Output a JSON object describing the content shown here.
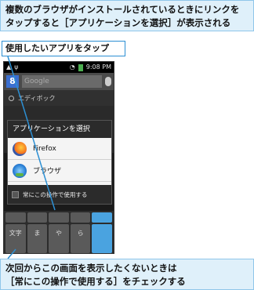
{
  "captions": {
    "top_line1": "複数のブラウザがインストールされているときにリンクを",
    "top_line2": "タップすると［アプリケーションを選択］が表示される",
    "callout": "使用したいアプリをタップ",
    "bottom_line1": "次回からこの画面を表示したくないときは",
    "bottom_line2": "［常にこの操作で使用する］をチェックする"
  },
  "statusbar": {
    "time": "9:08 PM"
  },
  "search": {
    "placeholder": "Google",
    "suggestion": "エディボック"
  },
  "dialog": {
    "title": "アプリケーションを選択",
    "apps": [
      {
        "label": "Firefox",
        "icon": "firefox-icon"
      },
      {
        "label": "ブラウザ",
        "icon": "browser-icon"
      }
    ],
    "always_use": "常にこの操作で使用する"
  },
  "keyboard": {
    "keys": [
      "",
      "",
      "",
      "",
      "",
      "文字",
      "",
      "",
      "",
      "",
      "",
      "ま",
      "や",
      "ら",
      "",
      "",
      "",
      "",
      "",
      ""
    ]
  },
  "colors": {
    "callout_border": "#2c8fd3",
    "caption_bg": "#dff0fa",
    "line": "#2c8fd3"
  }
}
